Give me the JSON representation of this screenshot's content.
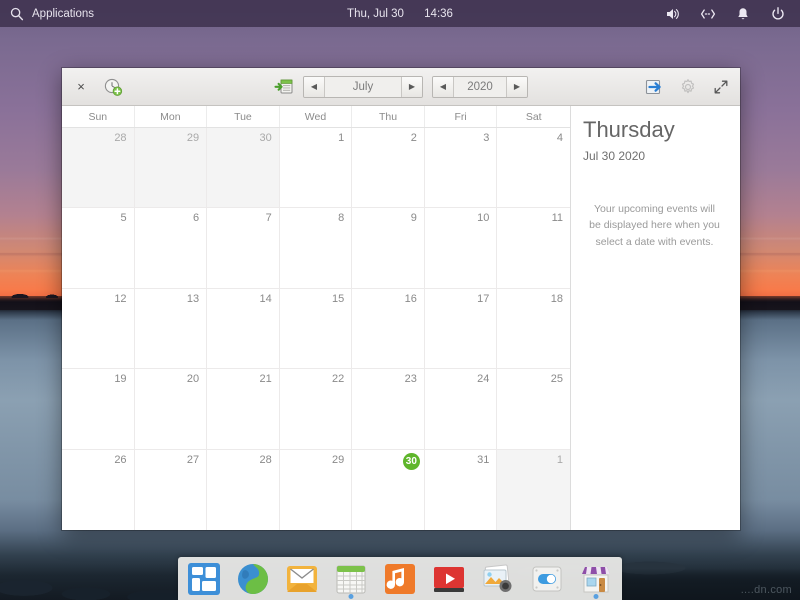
{
  "topbar": {
    "applications_label": "Applications",
    "search_icon": "search-icon",
    "date": "Thu, Jul 30",
    "time": "14:36",
    "tray": [
      {
        "name": "volume-icon",
        "label": "Volume"
      },
      {
        "name": "network-icon",
        "label": "Network"
      },
      {
        "name": "notifications-icon",
        "label": "Notifications"
      },
      {
        "name": "power-icon",
        "label": "Power"
      }
    ]
  },
  "window": {
    "app": "Calendar",
    "close_label": "×",
    "new_event_icon": "clock-add-icon",
    "today_icon": "today-icon",
    "export_icon": "export-icon",
    "settings_icon": "gear-icon",
    "fullscreen_icon": "expand-icon",
    "month": "July",
    "year": "2020",
    "prev_month_label": "◀",
    "next_month_label": "▶",
    "prev_year_label": "◀",
    "next_year_label": "▶"
  },
  "calendar": {
    "weekdays": [
      "Sun",
      "Mon",
      "Tue",
      "Wed",
      "Thu",
      "Fri",
      "Sat"
    ],
    "today": 30,
    "today_color": "#5fb62b",
    "weeks": [
      [
        {
          "d": "28",
          "other": true
        },
        {
          "d": "29",
          "other": true
        },
        {
          "d": "30",
          "other": true
        },
        {
          "d": "1"
        },
        {
          "d": "2"
        },
        {
          "d": "3"
        },
        {
          "d": "4"
        }
      ],
      [
        {
          "d": "5"
        },
        {
          "d": "6"
        },
        {
          "d": "7"
        },
        {
          "d": "8"
        },
        {
          "d": "9"
        },
        {
          "d": "10"
        },
        {
          "d": "11"
        }
      ],
      [
        {
          "d": "12"
        },
        {
          "d": "13"
        },
        {
          "d": "14"
        },
        {
          "d": "15"
        },
        {
          "d": "16"
        },
        {
          "d": "17"
        },
        {
          "d": "18"
        }
      ],
      [
        {
          "d": "19"
        },
        {
          "d": "20"
        },
        {
          "d": "21"
        },
        {
          "d": "22"
        },
        {
          "d": "23"
        },
        {
          "d": "24"
        },
        {
          "d": "25"
        }
      ],
      [
        {
          "d": "26"
        },
        {
          "d": "27"
        },
        {
          "d": "28"
        },
        {
          "d": "29"
        },
        {
          "d": "30",
          "today": true
        },
        {
          "d": "31"
        },
        {
          "d": "1",
          "other": true
        }
      ]
    ]
  },
  "side_panel": {
    "weekday": "Thursday",
    "date": "Jul 30 2020",
    "empty_message": "Your upcoming events will be displayed here when you select a date with events."
  },
  "dock": {
    "items": [
      {
        "name": "app-grid-icon",
        "label": "Applications"
      },
      {
        "name": "web-browser-icon",
        "label": "Web Browser"
      },
      {
        "name": "email-icon",
        "label": "Email"
      },
      {
        "name": "calendar-icon",
        "label": "Calendar",
        "running": true
      },
      {
        "name": "music-icon",
        "label": "Music"
      },
      {
        "name": "video-icon",
        "label": "Videos"
      },
      {
        "name": "photos-icon",
        "label": "Photos"
      },
      {
        "name": "settings-icon",
        "label": "System Settings"
      },
      {
        "name": "software-store-icon",
        "label": "Software",
        "running": true
      }
    ]
  },
  "desktop": {
    "watermark": "....dn.com"
  }
}
